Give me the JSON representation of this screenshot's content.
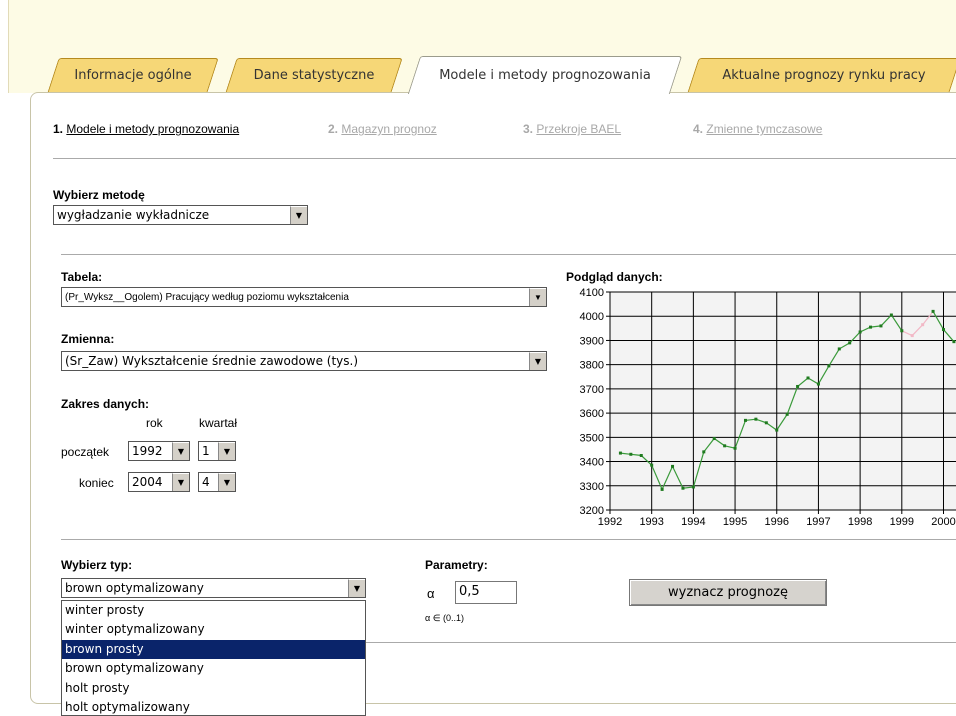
{
  "tabs": [
    {
      "label": "Informacje ogólne"
    },
    {
      "label": "Dane statystyczne"
    },
    {
      "label": "Modele i metody prognozowania"
    },
    {
      "label": "Aktualne prognozy rynku pracy"
    }
  ],
  "steps": [
    {
      "num": "1.",
      "label": "Modele i metody prognozowania"
    },
    {
      "num": "2.",
      "label": "Magazyn prognoz"
    },
    {
      "num": "3.",
      "label": "Przekroje BAEL"
    },
    {
      "num": "4.",
      "label": "Zmienne tymczasowe"
    }
  ],
  "method": {
    "label": "Wybierz metodę",
    "value": "wygładzanie wykładnicze"
  },
  "table": {
    "label": "Tabela:",
    "value": "(Pr_Wyksz__Ogolem) Pracujący według poziomu wykształcenia"
  },
  "variable": {
    "label": "Zmienna:",
    "value": "(Sr_Zaw) Wykształcenie średnie zawodowe (tys.)"
  },
  "range": {
    "label": "Zakres danych:",
    "year_header": "rok",
    "quarter_header": "kwartał",
    "start": {
      "label": "początek",
      "year": "1992",
      "quarter": "1"
    },
    "end": {
      "label": "koniec",
      "year": "2004",
      "quarter": "4"
    }
  },
  "preview_label": "Podgląd danych:",
  "type": {
    "label": "Wybierz typ:",
    "value": "brown optymalizowany",
    "options": [
      "winter prosty",
      "winter optymalizowany",
      "brown prosty",
      "brown optymalizowany",
      "holt prosty",
      "holt optymalizowany"
    ],
    "highlighted": "brown prosty"
  },
  "params": {
    "label": "Parametry:",
    "alpha_symbol": "α",
    "alpha_value": "0,5",
    "alpha_hint": "α ∈ (0..1)"
  },
  "forecast_button": "wyznacz prognozę",
  "colors": {
    "tab_fill": "#f6d777",
    "series_line": "#3a9a3a",
    "series_point": "#1f7a1f",
    "gap_segment": "#f2b8c6",
    "highlight": "#0a246a"
  },
  "chart_data": {
    "type": "line",
    "title": "",
    "xlabel": "",
    "ylabel": "",
    "xlim": [
      1992,
      2000.3
    ],
    "ylim": [
      3200,
      4100
    ],
    "yticks": [
      3200,
      3300,
      3400,
      3500,
      3600,
      3700,
      3800,
      3900,
      4000,
      4100
    ],
    "xticks": [
      1992,
      1993,
      1994,
      1995,
      1996,
      1997,
      1998,
      1999,
      2000
    ],
    "grid": true,
    "series": [
      {
        "x": [
          1992.25,
          1992.5,
          1992.75,
          1993.0,
          1993.25,
          1993.5,
          1993.75,
          1994.0,
          1994.25,
          1994.5,
          1994.75,
          1995.0,
          1995.25,
          1995.5,
          1995.75,
          1996.0,
          1996.25,
          1996.5,
          1996.75,
          1997.0,
          1997.25,
          1997.5,
          1997.75,
          1998.0,
          1998.25,
          1998.5,
          1998.75,
          1999.0,
          1999.25,
          1999.5,
          1999.75,
          2000.0,
          2000.25
        ],
        "values": [
          3435,
          3430,
          3425,
          3385,
          3285,
          3380,
          3290,
          3295,
          3440,
          3495,
          3465,
          3455,
          3570,
          3575,
          3560,
          3530,
          3595,
          3710,
          3745,
          3720,
          3795,
          3865,
          3890,
          3935,
          3955,
          3960,
          4005,
          3940,
          3920,
          3965,
          4020,
          3945,
          3895
        ]
      }
    ]
  }
}
